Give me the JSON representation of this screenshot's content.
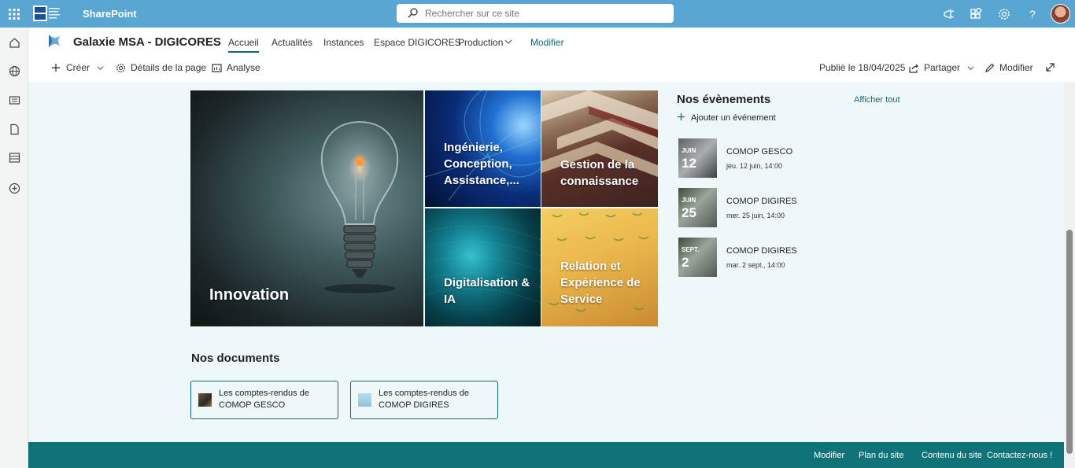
{
  "suite": {
    "brand": "SharePoint",
    "search_placeholder": "Rechercher sur ce site"
  },
  "site": {
    "title": "Galaxie MSA - DIGICORES",
    "nav": [
      {
        "label": "Accueil"
      },
      {
        "label": "Actualités"
      },
      {
        "label": "Instances"
      },
      {
        "label": "Espace DIGICORES"
      },
      {
        "label": "Production"
      },
      {
        "label": "Modifier"
      }
    ]
  },
  "commandbar": {
    "create": "Créer",
    "page_details": "Détails de la page",
    "analytics": "Analyse",
    "published": "Publié le 18/04/2025",
    "share": "Partager",
    "edit": "Modifier"
  },
  "hero": {
    "tiles": [
      {
        "label": "Innovation"
      },
      {
        "label": "Ingénierie, Conception, Assistance,..."
      },
      {
        "label": "Gestion de la connaissance"
      },
      {
        "label": "Digitalisation & IA"
      },
      {
        "label": "Relation et Expérience de Service"
      }
    ]
  },
  "documents": {
    "title": "Nos documents",
    "items": [
      {
        "label": "Les comptes-rendus de COMOP GESCO"
      },
      {
        "label": "Les comptes-rendus de COMOP DIGIRES"
      }
    ]
  },
  "events": {
    "title": "Nos évènements",
    "see_all": "Afficher tout",
    "add": "Ajouter un événement",
    "items": [
      {
        "month": "JUIN",
        "day": "12",
        "name": "COMOP GESCO",
        "time": "jeu. 12 juin, 14:00"
      },
      {
        "month": "JUIN",
        "day": "25",
        "name": "COMOP DIGIRES",
        "time": "mer. 25 juin, 14:00"
      },
      {
        "month": "SEPT.",
        "day": "2",
        "name": "COMOP DIGIRES",
        "time": "mar. 2 sept., 14:00"
      }
    ]
  },
  "footer": {
    "links": [
      {
        "label": "Modifier"
      },
      {
        "label": "Plan du site"
      },
      {
        "label": "Contenu du site"
      },
      {
        "label": "Contactez-nous !"
      }
    ]
  },
  "colors": {
    "suite_bar": "#5aa6d2",
    "accent": "#0f6c74",
    "footer": "#0f7378",
    "page_bg": "#eff8f8"
  }
}
